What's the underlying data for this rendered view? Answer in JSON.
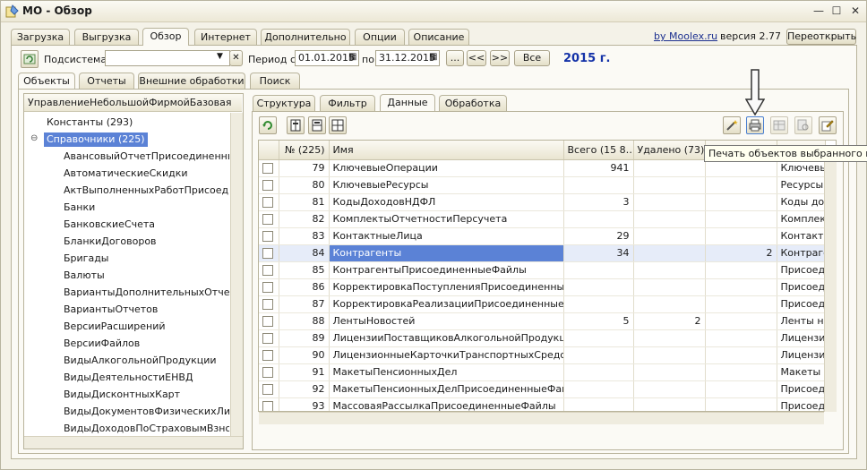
{
  "window": {
    "title": "МО - Обзор",
    "minimize": "—",
    "maximize": "☐",
    "close": "✕"
  },
  "main_tabs": [
    {
      "label": "Загрузка"
    },
    {
      "label": "Выгрузка"
    },
    {
      "label": "Обзор"
    },
    {
      "label": "Интернет"
    },
    {
      "label": "Дополнительно"
    },
    {
      "label": "Опции"
    },
    {
      "label": "Описание"
    }
  ],
  "header": {
    "by_link": "by Moolex.ru",
    "version": "версия 2.77",
    "reopen_button": "Переоткрыть"
  },
  "filterbar": {
    "subsystem_label": "Подсистема:",
    "subsystem_value": "",
    "clear_symbol": "✕",
    "period_label": "Период с:",
    "date_from": "01.01.2015",
    "to_label": "по:",
    "date_to": "31.12.2015",
    "ellipsis_button": "...",
    "prev_button": "<<",
    "next_button": ">>",
    "all_button": "Все",
    "year": "2015 г."
  },
  "sub_tabs": [
    {
      "label": "Объекты"
    },
    {
      "label": "Отчеты"
    },
    {
      "label": "Внешние обработки"
    },
    {
      "label": "Поиск"
    }
  ],
  "tree": {
    "header": "УправлениеНебольшойФирмойБазовая",
    "items": [
      {
        "label": "Константы (293)"
      },
      {
        "label": "Справочники (225)"
      },
      {
        "label": "АвансовыйОтчетПрисоединенныеФ"
      },
      {
        "label": "АвтоматическиеСкидки"
      },
      {
        "label": "АктВыполненныхРаботПрисоединен"
      },
      {
        "label": "Банки"
      },
      {
        "label": "БанковскиеСчета"
      },
      {
        "label": "БланкиДоговоров"
      },
      {
        "label": "Бригады"
      },
      {
        "label": "Валюты"
      },
      {
        "label": "ВариантыДополнительныхОтчетов"
      },
      {
        "label": "ВариантыОтчетов"
      },
      {
        "label": "ВерсииРасширений"
      },
      {
        "label": "ВерсииФайлов"
      },
      {
        "label": "ВидыАлкогольнойПродукции"
      },
      {
        "label": "ВидыДеятельностиЕНВД"
      },
      {
        "label": "ВидыДисконтныхКарт"
      },
      {
        "label": "ВидыДокументовФизическихЛиц"
      },
      {
        "label": "ВидыДоходовПоСтраховымВзносам"
      }
    ]
  },
  "right_tabs": [
    {
      "label": "Структура"
    },
    {
      "label": "Фильтр"
    },
    {
      "label": "Данные"
    },
    {
      "label": "Обработка"
    }
  ],
  "grid": {
    "columns": [
      "",
      "№ (225)",
      "Имя",
      "Всего (15 8…",
      "Удалено (73)",
      "",
      ""
    ],
    "rows": [
      {
        "n": "79",
        "name": "КлючевыеОперации",
        "total": "941",
        "deleted": "",
        "extra": "",
        "synonym": "Ключевые"
      },
      {
        "n": "80",
        "name": "КлючевыеРесурсы",
        "total": "",
        "deleted": "",
        "extra": "",
        "synonym": "Ресурсы"
      },
      {
        "n": "81",
        "name": "КодыДоходовНДФЛ",
        "total": "3",
        "deleted": "",
        "extra": "",
        "synonym": "Коды дох"
      },
      {
        "n": "82",
        "name": "КомплектыОтчетностиПерсучета",
        "total": "",
        "deleted": "",
        "extra": "",
        "synonym": "Комплект"
      },
      {
        "n": "83",
        "name": "КонтактныеЛица",
        "total": "29",
        "deleted": "",
        "extra": "",
        "synonym": "Контактн"
      },
      {
        "n": "84",
        "name": "Контрагенты",
        "total": "34",
        "deleted": "",
        "extra": "2",
        "synonym": "Контраге"
      },
      {
        "n": "85",
        "name": "КонтрагентыПрисоединенныеФайлы",
        "total": "",
        "deleted": "",
        "extra": "",
        "synonym": "Присоеди"
      },
      {
        "n": "86",
        "name": "КорректировкаПоступленияПрисоединенныеФ…",
        "total": "",
        "deleted": "",
        "extra": "",
        "synonym": "Присоеди"
      },
      {
        "n": "87",
        "name": "КорректировкаРеализацииПрисоединенныеФа…",
        "total": "",
        "deleted": "",
        "extra": "",
        "synonym": "Присоеди"
      },
      {
        "n": "88",
        "name": "ЛентыНовостей",
        "total": "5",
        "deleted": "2",
        "extra": "",
        "synonym": "Ленты но"
      },
      {
        "n": "89",
        "name": "ЛицензииПоставщиковАлкогольнойПродукции",
        "total": "",
        "deleted": "",
        "extra": "",
        "synonym": "Лицензи"
      },
      {
        "n": "90",
        "name": "ЛицензионныеКарточкиТранспортныхСредств",
        "total": "",
        "deleted": "",
        "extra": "",
        "synonym": "Лицензи"
      },
      {
        "n": "91",
        "name": "МакетыПенсионныхДел",
        "total": "",
        "deleted": "",
        "extra": "",
        "synonym": "Макеты п"
      },
      {
        "n": "92",
        "name": "МакетыПенсионныхДелПрисоединенныеФайлы",
        "total": "",
        "deleted": "",
        "extra": "",
        "synonym": "Присоеди"
      },
      {
        "n": "93",
        "name": "МассоваяРассылкаПрисоединенныеФайлы",
        "total": "",
        "deleted": "",
        "extra": "",
        "synonym": "Присоеди"
      }
    ]
  },
  "tooltip": "Печать объектов выбранного вида",
  "colors": {
    "accent_blue": "#1432a8",
    "selection": "#5b82d6",
    "window_bg": "#f4f2e8"
  }
}
